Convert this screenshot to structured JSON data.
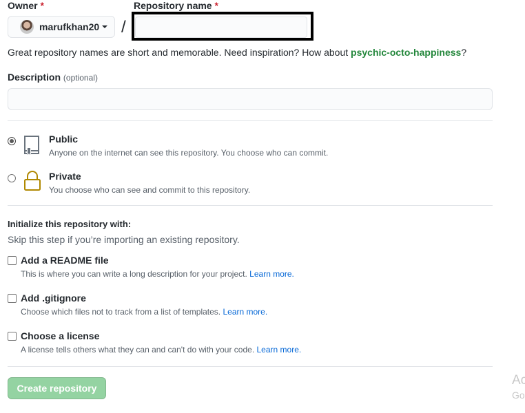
{
  "owner": {
    "label": "Owner",
    "required_mark": "*",
    "username": "marufkhan20"
  },
  "separator": "/",
  "repo_name": {
    "label": "Repository name",
    "required_mark": "*",
    "value": "",
    "placeholder": ""
  },
  "hint": {
    "text": "Great repository names are short and memorable. Need inspiration? How about ",
    "suggestion": "psychic-octo-happiness",
    "suffix": "?"
  },
  "description": {
    "label": "Description",
    "optional": "(optional)",
    "value": "",
    "placeholder": ""
  },
  "visibility": {
    "selected": "public",
    "options": [
      {
        "id": "public",
        "title": "Public",
        "description": "Anyone on the internet can see this repository. You choose who can commit.",
        "icon": "repo-icon"
      },
      {
        "id": "private",
        "title": "Private",
        "description": "You choose who can see and commit to this repository.",
        "icon": "lock-icon",
        "icon_color": "#b08800"
      }
    ]
  },
  "init": {
    "heading": "Initialize this repository with:",
    "subheading": "Skip this step if you’re importing an existing repository.",
    "options": [
      {
        "title": "Add a README file",
        "description": "This is where you can write a long description for your project.",
        "link": "Learn more."
      },
      {
        "title": "Add .gitignore",
        "description": "Choose which files not to track from a list of templates.",
        "link": "Learn more."
      },
      {
        "title": "Choose a license",
        "description": "A license tells others what they can and can't do with your code.",
        "link": "Learn more."
      }
    ]
  },
  "create_button": {
    "label": "Create repository",
    "color": "#94d3a2"
  },
  "watermark": {
    "line1": "Ac",
    "line2": "Go"
  }
}
